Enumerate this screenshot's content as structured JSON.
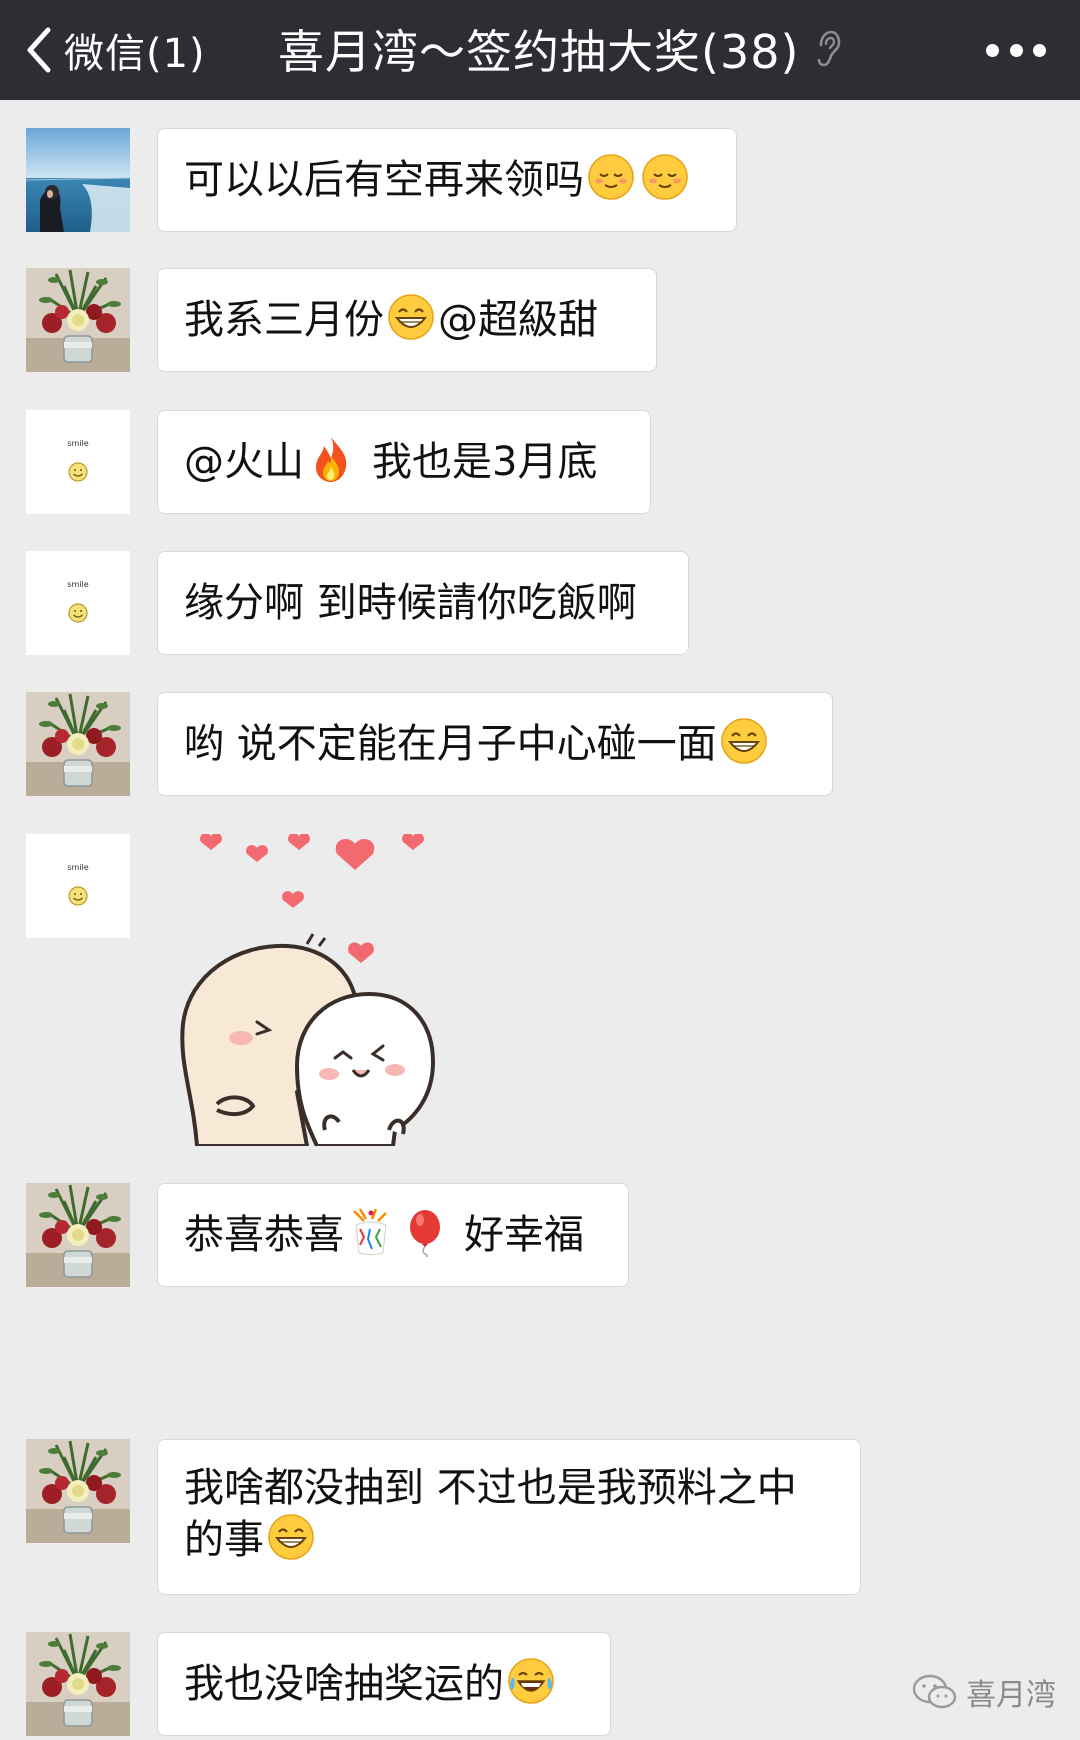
{
  "header": {
    "back_label": "微信(1)",
    "title": "喜月湾～签约抽大奖(38)",
    "background": "#2d2e33"
  },
  "messages": [
    {
      "avatar": "sea-photo-avatar",
      "parts": [
        "可以以后有空再来领吗"
      ],
      "emojis": [
        "blush-emoji",
        "blush-emoji"
      ]
    },
    {
      "avatar": "flower-vase-avatar",
      "parts": [
        "我系三月份",
        "@超級甜"
      ],
      "emojis": [
        "grin-emoji"
      ]
    },
    {
      "avatar": "smile-card-avatar",
      "parts": [
        "@火山",
        "我也是3月底"
      ],
      "emojis": [
        "fire-emoji"
      ]
    },
    {
      "avatar": "smile-card-avatar",
      "parts": [
        "缘分啊 到時候請你吃飯啊"
      ]
    },
    {
      "avatar": "flower-vase-avatar",
      "parts": [
        "哟 说不定能在月子中心碰一面"
      ],
      "emojis": [
        "grin-emoji"
      ]
    },
    {
      "avatar": "smile-card-avatar",
      "sticker": "hugging-bunnies-sticker"
    },
    {
      "avatar": "flower-vase-avatar",
      "parts": [
        "恭喜恭喜",
        "好幸福"
      ],
      "emojis": [
        "confetti-emoji",
        "balloon-emoji"
      ]
    },
    {
      "avatar": "flower-vase-avatar",
      "parts": [
        "我啥都没抽到 不过也是我预料之中",
        "的事"
      ],
      "emojis": [
        "grin-emoji"
      ]
    },
    {
      "avatar": "flower-vase-avatar",
      "parts": [
        "我也没啥抽奖运的"
      ],
      "emojis": [
        "tears-of-joy-emoji"
      ]
    }
  ],
  "avatar_card_text": "smile",
  "watermark": {
    "label": "喜月湾"
  },
  "colors": {
    "chat_background": "#ececec",
    "bubble": "#ffffff",
    "header": "#2d2e33"
  }
}
